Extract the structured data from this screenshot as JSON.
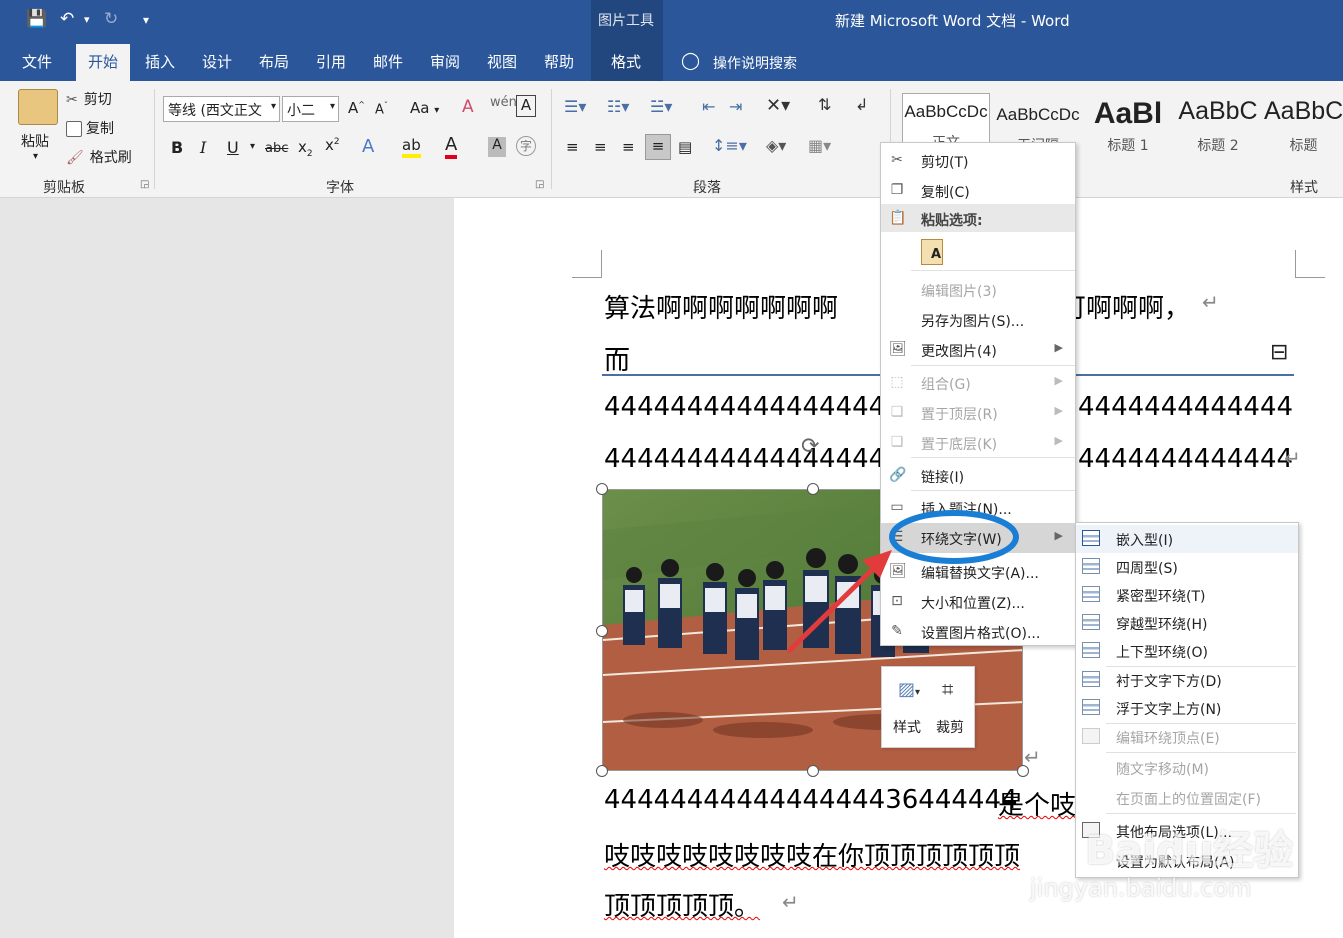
{
  "window": {
    "title": "新建 Microsoft Word 文档  -  Word",
    "context_group": "图片工具"
  },
  "qat": {
    "save_icon": "save-icon",
    "undo_icon": "undo-icon",
    "redo_icon": "redo-icon",
    "customize": "▾"
  },
  "tabs": [
    {
      "label": "文件"
    },
    {
      "label": "开始"
    },
    {
      "label": "插入"
    },
    {
      "label": "设计"
    },
    {
      "label": "布局"
    },
    {
      "label": "引用"
    },
    {
      "label": "邮件"
    },
    {
      "label": "审阅"
    },
    {
      "label": "视图"
    },
    {
      "label": "帮助"
    },
    {
      "label": "格式"
    }
  ],
  "tell_me": "操作说明搜索",
  "clipboard": {
    "paste": "粘贴",
    "cut": "剪切",
    "copy": "复制",
    "format_painter": "格式刷",
    "group": "剪贴板"
  },
  "font": {
    "name": "等线 (西文正文",
    "size": "小二",
    "case": "Aa",
    "group": "字体"
  },
  "paragraph": {
    "group": "段落"
  },
  "styles": {
    "items": [
      {
        "sample": "AaBbCcDc",
        "name": "正文"
      },
      {
        "sample": "AaBbCcDc",
        "name": "无间隔"
      },
      {
        "sample": "AaBl",
        "name": "标题 1"
      },
      {
        "sample": "AaBbC",
        "name": "标题 2"
      },
      {
        "sample": "AaBbC",
        "name": "标题"
      }
    ],
    "group": "样式"
  },
  "document": {
    "line1_left": "算法啊啊啊啊啊啊啊",
    "line1_right": "可啊啊啊，",
    "line2": "而",
    "line3_left": "44444444444444444",
    "line3_right": "4444444444444",
    "line4_left": "44444444444444444",
    "line4_right": "4444444444444",
    "line5_left": "4444444444444444436444444",
    "line5_right": "是个吱",
    "line6": "吱吱吱吱吱吱吱吱在你顶顶顶顶顶顶",
    "line7": "顶顶顶顶顶。"
  },
  "context_menu": {
    "cut": "剪切(T)",
    "copy": "复制(C)",
    "paste_options": "粘贴选项:",
    "edit_picture": "编辑图片(3)",
    "save_as_picture": "另存为图片(S)...",
    "change_picture": "更改图片(4)",
    "group": "组合(G)",
    "bring_front": "置于顶层(R)",
    "send_back": "置于底层(K)",
    "link": "链接(I)",
    "insert_caption": "插入题注(N)...",
    "wrap_text": "环绕文字(W)",
    "edit_alt_text": "编辑替换文字(A)...",
    "size_position": "大小和位置(Z)...",
    "format_picture": "设置图片格式(O)..."
  },
  "wrap_submenu": [
    {
      "label": "嵌入型(I)",
      "enabled": true
    },
    {
      "label": "四周型(S)",
      "enabled": true
    },
    {
      "label": "紧密型环绕(T)",
      "enabled": true
    },
    {
      "label": "穿越型环绕(H)",
      "enabled": true
    },
    {
      "label": "上下型环绕(O)",
      "enabled": true
    },
    {
      "label": "衬于文字下方(D)",
      "enabled": true
    },
    {
      "label": "浮于文字上方(N)",
      "enabled": true
    },
    {
      "label": "编辑环绕顶点(E)",
      "enabled": false
    },
    {
      "label": "随文字移动(M)",
      "enabled": false
    },
    {
      "label": "在页面上的位置固定(F)",
      "enabled": false
    },
    {
      "label": "其他布局选项(L)...",
      "enabled": true
    },
    {
      "label": "设置为默认布局(A)",
      "enabled": true
    }
  ],
  "float_toolbar": {
    "style": "样式",
    "crop": "裁剪"
  },
  "watermark": {
    "brand": "Baidu经验",
    "url": "jingyan.baidu.com"
  },
  "colors": {
    "word_blue": "#2b579a",
    "annotation_circle": "#1a7fd4",
    "arrow": "#e23b3b"
  }
}
